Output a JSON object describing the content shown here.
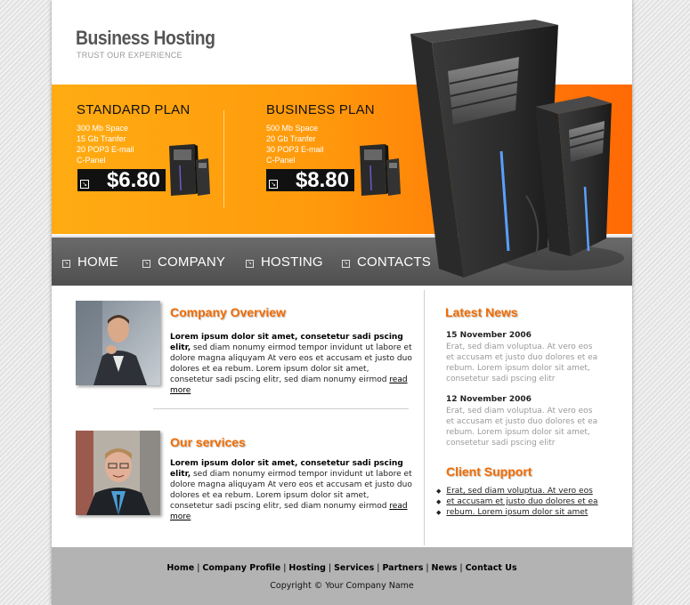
{
  "header": {
    "logo_title": "Business Hosting",
    "logo_tagline": "TRUST OUR EXPERIENCE"
  },
  "plans": [
    {
      "title": "STANDARD PLAN",
      "features": [
        "300 Mb Space",
        "15 Gb Tranfer",
        "20 POP3 E-mail",
        "C-Panel"
      ],
      "price": "$6.80"
    },
    {
      "title": "BUSINESS PLAN",
      "features": [
        "500 Mb Space",
        "20 Gb Tranfer",
        "30 POP3 E-mail",
        "C-Panel"
      ],
      "price": "$8.80"
    }
  ],
  "nav": {
    "items": [
      "HOME",
      "COMPANY",
      "HOSTING",
      "CONTACTS"
    ]
  },
  "main": {
    "sections": [
      {
        "title": "Company Overview",
        "lead": "Lorem ipsum dolor sit amet, consetetur sadi pscing elitr,",
        "body": " sed diam nonumy eirmod tempor invidunt ut labore et dolore magna aliquyam At vero eos et accusam et justo duo dolores et ea rebum. Lorem ipsum dolor sit amet, consetetur sadi pscing elitr, sed diam nonumy eirmod ",
        "read_more": "read more"
      },
      {
        "title": "Our services",
        "lead": "Lorem ipsum dolor sit amet, consetetur sadi pscing elitr,",
        "body": " sed diam nonumy eirmod tempor invidunt ut labore et dolore magna aliquyam At vero eos et accusam et justo duo dolores et ea rebum. Lorem ipsum dolor sit amet, consetetur sadi pscing elitr, sed diam nonumy eirmod ",
        "read_more": "read more"
      }
    ]
  },
  "sidebar": {
    "news_title": "Latest News",
    "news": [
      {
        "date": "15 November 2006",
        "text": "Erat, sed diam voluptua. At vero eos et accusam et justo duo dolores et ea rebum. Lorem ipsum dolor sit amet, consetetur sadi pscing elitr"
      },
      {
        "date": "12 November 2006",
        "text": "Erat, sed diam voluptua. At vero eos et accusam et justo duo dolores et ea rebum. Lorem ipsum dolor sit amet, consetetur sadi pscing elitr"
      }
    ],
    "support_title": "Client Support",
    "support_links": [
      "Erat, sed diam voluptua. At vero eos",
      "et accusam et justo duo dolores et ea",
      "rebum. Lorem ipsum dolor sit amet"
    ]
  },
  "footer": {
    "links": [
      "Home",
      "Company Profile",
      "Hosting",
      "Services",
      "Partners",
      "News",
      "Contact Us"
    ],
    "copyright": "Copyright © Your Company Name"
  },
  "colors": {
    "accent_orange": "#ff8a0a",
    "title_orange": "#f26b00",
    "nav_gray": "#5c5c5c",
    "footer_gray": "#b3b3b3"
  }
}
